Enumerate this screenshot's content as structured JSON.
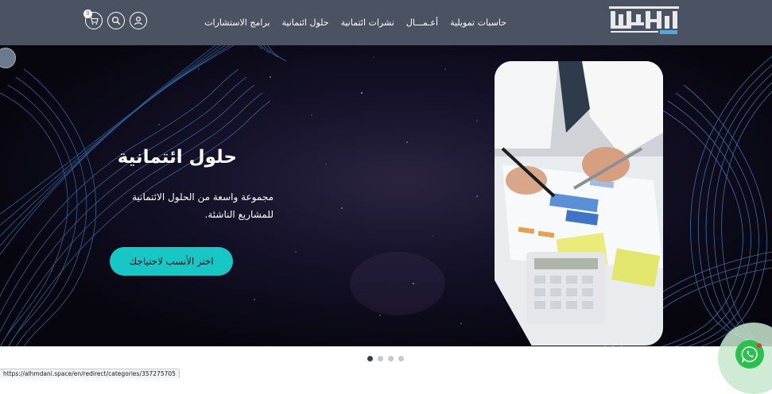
{
  "header": {
    "logo_alt": "المدني",
    "nav": [
      {
        "label": "حاسبات تمويلية"
      },
      {
        "label": "أعـمـــال"
      },
      {
        "label": "نشرات ائتمانية"
      },
      {
        "label": "حلول ائتمانية"
      },
      {
        "label": "برامج الاستشارات"
      }
    ],
    "cart_count": "0",
    "icons": [
      "user-icon",
      "search-icon",
      "cart-icon"
    ]
  },
  "hero": {
    "title": "حلول ائتمانية",
    "subtitle": "مجموعة واسعة من الحلول الائتمانية للمشاريع الناشئة.",
    "cta_label": "اختر الأنسب لاحتياجك"
  },
  "slider": {
    "dot_count": 4,
    "active_index": 0
  },
  "status_bar": {
    "url": "https://alhmdani.space/en/redirect/categories/357275705"
  },
  "colors": {
    "header_bg": "#4b5363",
    "cta_bg": "#19c6c6",
    "whatsapp": "#2bbf4e",
    "wave": "#3a7fc4"
  }
}
